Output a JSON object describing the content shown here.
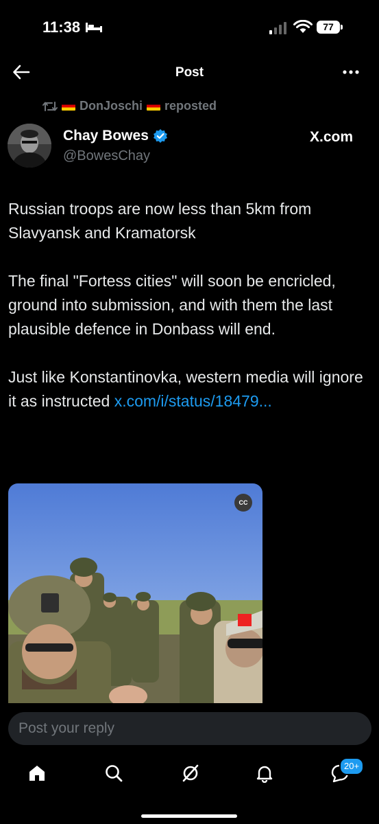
{
  "status_bar": {
    "time": "11:38",
    "battery": "77"
  },
  "header": {
    "title": "Post"
  },
  "repost": {
    "user": "DonJoschi",
    "suffix": "reposted"
  },
  "author": {
    "name": "Chay Bowes",
    "handle": "@BowesChay",
    "verified": true,
    "source": "X.com"
  },
  "tweet": {
    "paragraph1": "Russian troops are now less than 5km from Slavyansk and Kramatorsk",
    "paragraph2": "The final \"Fortess cities\" will soon be encricled, ground into submission, and with them the last plausible defence in Donbass will end.",
    "paragraph3": "Just like Konstantinovka, western media will ignore it as instructed ",
    "link": "x.com/i/status/18479..."
  },
  "media": {
    "cc_label": "CC"
  },
  "reply": {
    "placeholder": "Post your reply"
  },
  "tabbar": {
    "notifications_badge": "20+"
  },
  "colors": {
    "background": "#000000",
    "accent": "#1d9bf0",
    "muted": "#71767b"
  }
}
